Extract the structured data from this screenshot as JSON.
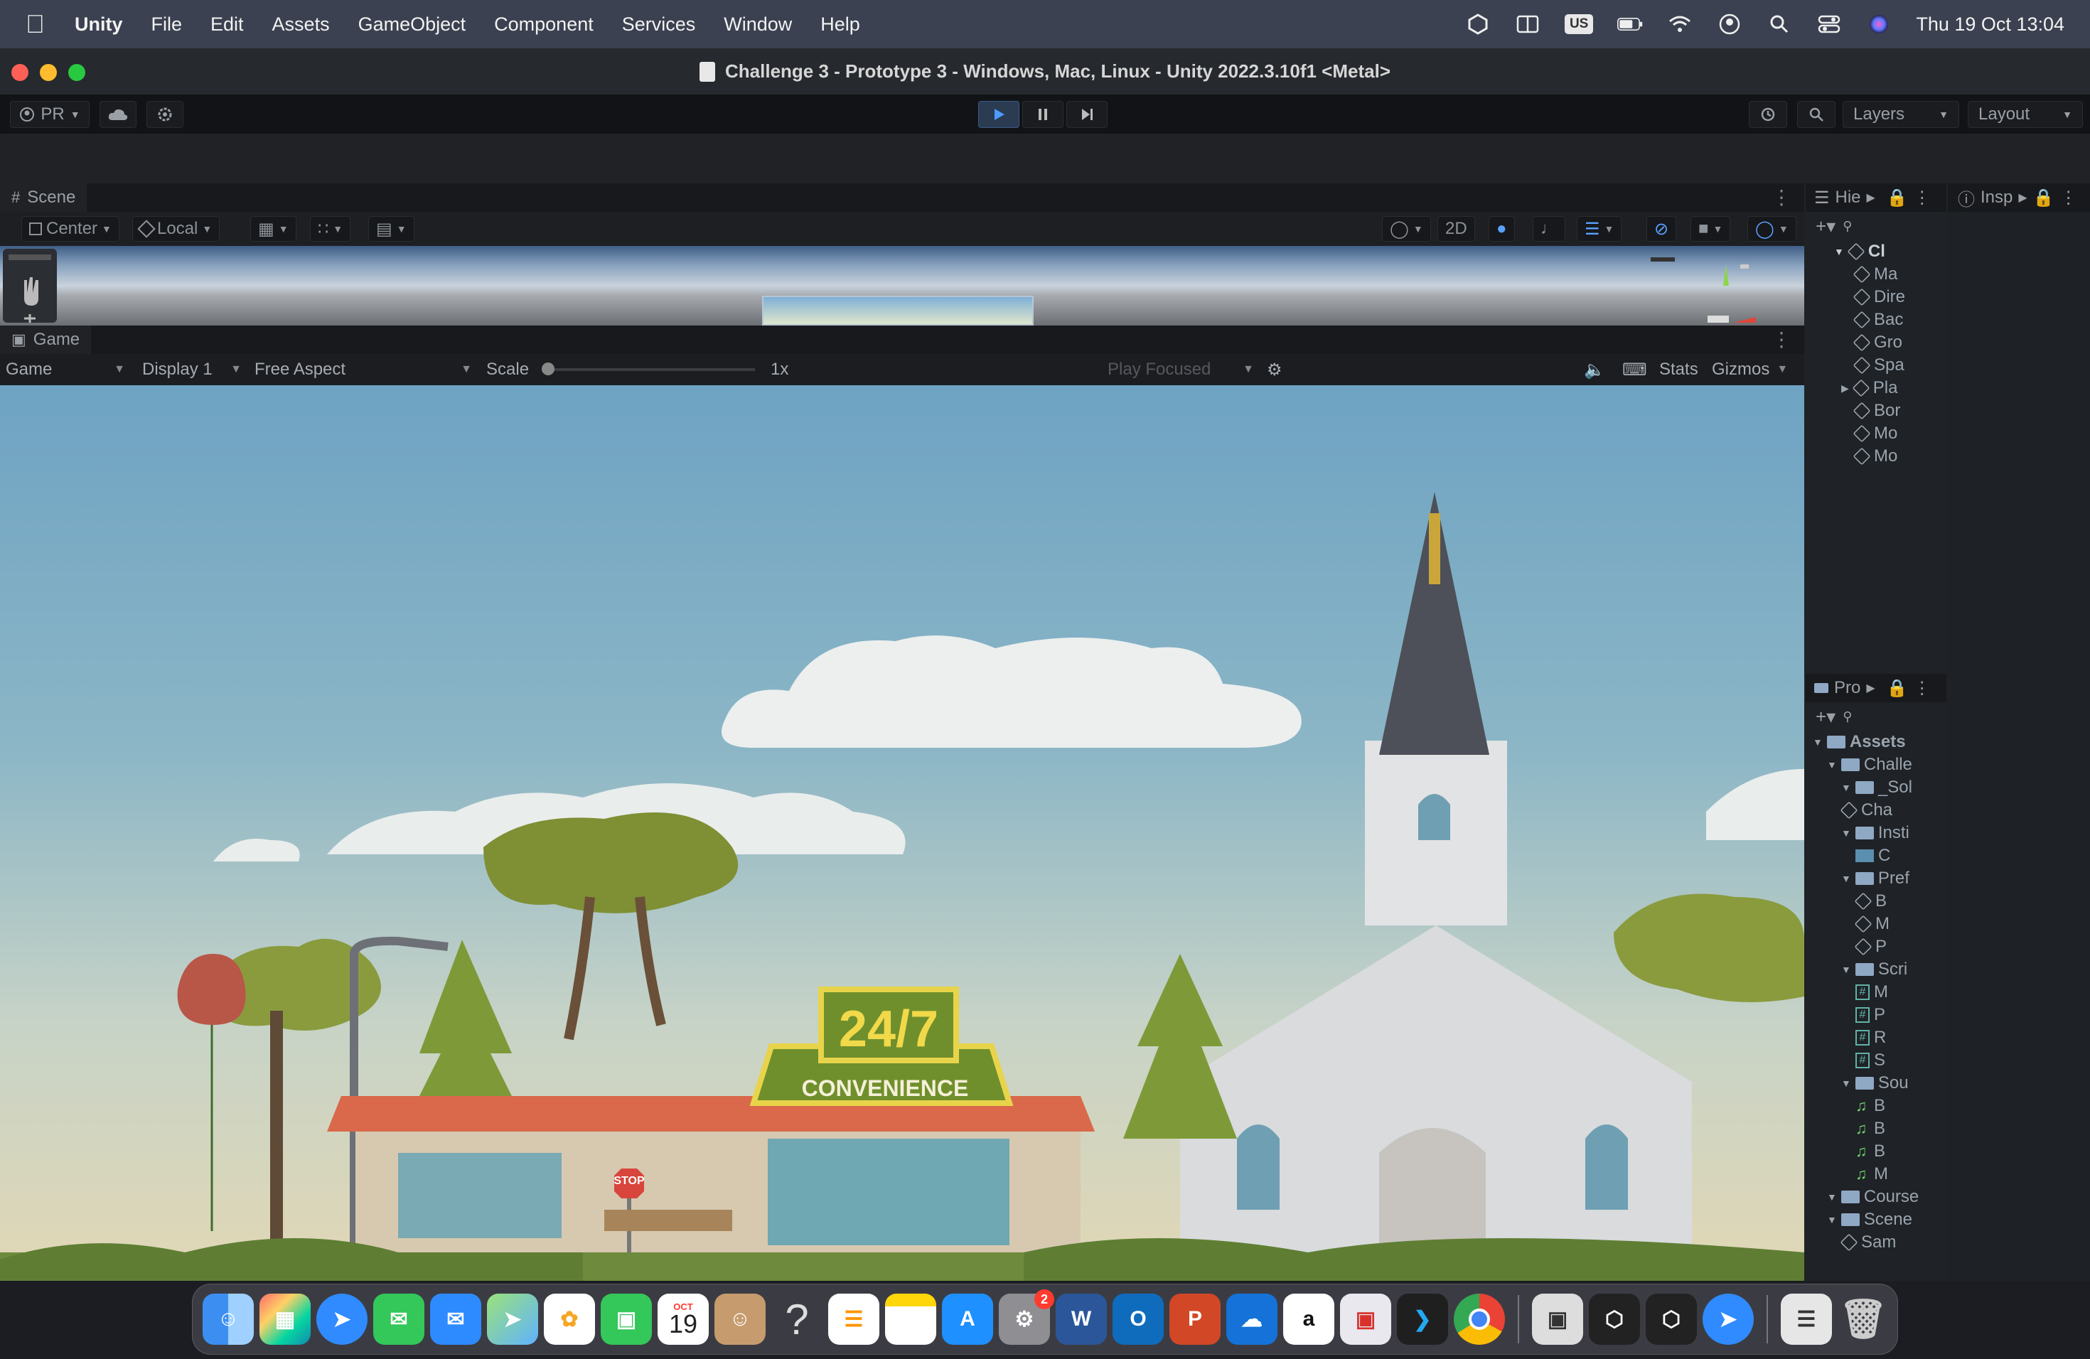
{
  "menubar": {
    "app_name": "Unity",
    "items": [
      "File",
      "Edit",
      "Assets",
      "GameObject",
      "Component",
      "Services",
      "Window",
      "Help"
    ],
    "keyboard_layout": "US",
    "clock": "Thu 19 Oct  13:04"
  },
  "window": {
    "title": "Challenge 3 - Prototype 3 - Windows, Mac, Linux - Unity 2022.3.10f1 <Metal>"
  },
  "toolbar": {
    "account_label": "PR",
    "layers_label": "Layers",
    "layout_label": "Layout"
  },
  "scene": {
    "tab_label": "Scene",
    "pivot_label": "Center",
    "space_label": "Local",
    "mode_2d_label": "2D"
  },
  "game": {
    "tab_label": "Game",
    "view_dropdown": "Game",
    "display_dropdown": "Display 1",
    "aspect_dropdown": "Free Aspect",
    "scale_label": "Scale",
    "scale_value": "1x",
    "play_mode_dropdown": "Play Focused",
    "stats_label": "Stats",
    "gizmos_label": "Gizmos",
    "scene_text": {
      "store_sign_top": "24/7",
      "store_sign_bottom": "CONVENIENCE",
      "stop_sign": "STOP"
    }
  },
  "hierarchy": {
    "tab_label": "Hie",
    "scene_root": "Cl",
    "items": [
      "Ma",
      "Dire",
      "Bac",
      "Gro",
      "Spa",
      "Pla",
      "Bor",
      "Mo",
      "Mo"
    ]
  },
  "inspector": {
    "tab_label": "Insp"
  },
  "project": {
    "tab_label": "Pro",
    "rows": [
      {
        "label": "Assets",
        "type": "folder",
        "depth": 0
      },
      {
        "label": "Challe",
        "type": "folder",
        "depth": 1
      },
      {
        "label": "_Sol",
        "type": "folder",
        "depth": 2
      },
      {
        "label": "Cha",
        "type": "scene",
        "depth": 2
      },
      {
        "label": "Insti",
        "type": "folder",
        "depth": 2
      },
      {
        "label": "C",
        "type": "image",
        "depth": 3
      },
      {
        "label": "Pref",
        "type": "folder",
        "depth": 2
      },
      {
        "label": "B",
        "type": "prefab",
        "depth": 3
      },
      {
        "label": "M",
        "type": "prefab",
        "depth": 3
      },
      {
        "label": "P",
        "type": "prefab",
        "depth": 3
      },
      {
        "label": "Scri",
        "type": "folder",
        "depth": 2
      },
      {
        "label": "M",
        "type": "script",
        "depth": 3
      },
      {
        "label": "P",
        "type": "script",
        "depth": 3
      },
      {
        "label": "R",
        "type": "script",
        "depth": 3
      },
      {
        "label": "S",
        "type": "script",
        "depth": 3
      },
      {
        "label": "Sou",
        "type": "folder",
        "depth": 2
      },
      {
        "label": "B",
        "type": "audio",
        "depth": 3
      },
      {
        "label": "B",
        "type": "audio",
        "depth": 3
      },
      {
        "label": "B",
        "type": "audio",
        "depth": 3
      },
      {
        "label": "M",
        "type": "audio",
        "depth": 3
      },
      {
        "label": "Course",
        "type": "folder",
        "depth": 1
      },
      {
        "label": "Scene",
        "type": "folder",
        "depth": 1
      },
      {
        "label": "Sam",
        "type": "scene",
        "depth": 2
      }
    ]
  },
  "dock": {
    "calendar_month": "OCT",
    "calendar_day": "19",
    "settings_badge": "2",
    "apps": [
      "finder-icon",
      "launchpad-icon",
      "safari-icon",
      "messages-icon",
      "mail-icon",
      "maps-icon",
      "photos-icon",
      "facetime-icon",
      "calendar-icon",
      "contacts-icon",
      "help-icon",
      "reminders-icon",
      "notes-icon",
      "app-store-icon",
      "system-settings-icon",
      "word-icon",
      "outlook-icon",
      "powerpoint-icon",
      "onedrive-icon",
      "amazon-icon",
      "remote-desktop-icon",
      "vscode-icon",
      "chrome-icon",
      "unity-hub-icon",
      "unity-icon",
      "unity-editor-icon",
      "safari-downloads-icon",
      "downloads-stack-icon",
      "trash-icon"
    ]
  },
  "colors": {
    "menubar_bg": "#3b4150",
    "editor_bg": "#202226",
    "sky_top": "#6ea3c3",
    "store_sign": "#6f8f2c",
    "roof": "#d9694a"
  }
}
